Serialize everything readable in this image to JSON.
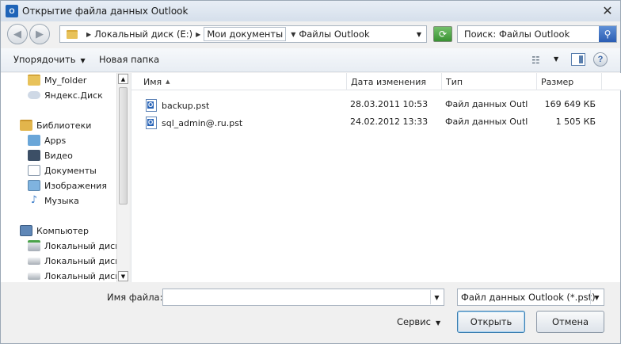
{
  "window": {
    "title": "Открытие файла данных Outlook",
    "app_icon_text": "O"
  },
  "address": {
    "crumbs": [
      "Локальный диск (E:)",
      "Мои документы",
      "Файлы Outlook"
    ]
  },
  "search": {
    "value": "Поиск: Файлы Outlook"
  },
  "toolbar": {
    "organize": "Упорядочить",
    "new_folder": "Новая папка"
  },
  "nav": {
    "items": [
      {
        "label": "My_folder",
        "icon": "folder-icon"
      },
      {
        "label": "Яндекс.Диск",
        "icon": "cloud-icon"
      },
      {
        "label": "Библиотеки",
        "icon": "library-icon"
      },
      {
        "label": "Apps",
        "icon": "apps-icon"
      },
      {
        "label": "Видео",
        "icon": "video-icon"
      },
      {
        "label": "Документы",
        "icon": "documents-icon"
      },
      {
        "label": "Изображения",
        "icon": "pictures-icon"
      },
      {
        "label": "Музыка",
        "icon": "music-icon"
      },
      {
        "label": "Компьютер",
        "icon": "computer-icon"
      },
      {
        "label": "Локальный диск (",
        "icon": "disk-icon"
      },
      {
        "label": "Локальный диск (",
        "icon": "disk-icon"
      },
      {
        "label": "Локальный диск (",
        "icon": "disk-icon"
      }
    ]
  },
  "columns": {
    "name": "Имя",
    "date": "Дата изменения",
    "type": "Тип",
    "size": "Размер"
  },
  "files": [
    {
      "name": "backup.pst",
      "date": "28.03.2011 10:53",
      "type": "Файл данных Outlook",
      "size": "169 649 КБ"
    },
    {
      "name": "sql_admin@.ru.pst",
      "date": "24.02.2012 13:33",
      "type": "Файл данных Outlook",
      "size": "1 505 КБ"
    }
  ],
  "bottom": {
    "filename_label": "Имя файла:",
    "filename_value": "",
    "filter": "Файл данных Outlook (*.pst)",
    "service": "Сервис",
    "open": "Открыть",
    "cancel": "Отмена"
  }
}
